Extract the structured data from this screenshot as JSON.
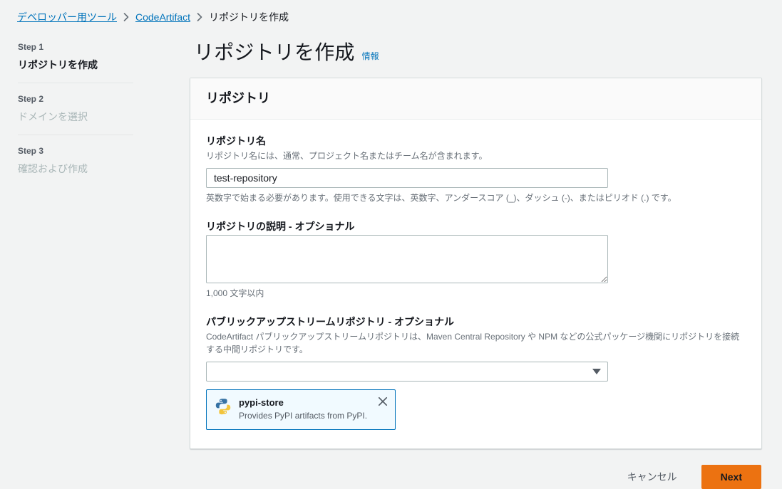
{
  "breadcrumb": {
    "items": [
      {
        "label": "デベロッパー用ツール",
        "type": "link"
      },
      {
        "label": "CodeArtifact",
        "type": "link"
      },
      {
        "label": "リポジトリを作成",
        "type": "current"
      }
    ]
  },
  "sidebar": {
    "steps": [
      {
        "step_label": "Step 1",
        "title": "リポジトリを作成",
        "state": "active"
      },
      {
        "step_label": "Step 2",
        "title": "ドメインを選択",
        "state": "inactive"
      },
      {
        "step_label": "Step 3",
        "title": "確認および作成",
        "state": "inactive"
      }
    ]
  },
  "page": {
    "title": "リポジトリを作成",
    "info_link": "情報"
  },
  "card": {
    "header": "リポジトリ",
    "fields": {
      "repo_name": {
        "label": "リポジトリ名",
        "description": "リポジトリ名には、通常、プロジェクト名またはチーム名が含まれます。",
        "value": "test-repository",
        "placeholder": "",
        "constraint": "英数字で始まる必要があります。使用できる文字は、英数字、アンダースコア (_)、ダッシュ (-)、またはピリオド (.) です。"
      },
      "repo_description": {
        "label": "リポジトリの説明 - オプショナル",
        "value": "",
        "placeholder": "",
        "constraint": "1,000 文字以内"
      },
      "upstream": {
        "label": "パブリックアップストリームリポジトリ - オプショナル",
        "description": "CodeArtifact パブリックアップストリームリポジトリは、Maven Central Repository や NPM などの公式パッケージ機関にリポジトリを接続する中間リポジトリです。",
        "selected_value": "",
        "dropdown_icon": "chevron-down-icon",
        "tokens": [
          {
            "icon": "python-logo-icon",
            "title": "pypi-store",
            "subtitle": "Provides PyPI artifacts from PyPI.",
            "remove_icon": "close-icon"
          }
        ]
      }
    }
  },
  "footer": {
    "cancel_label": "キャンセル",
    "next_label": "Next"
  },
  "colors": {
    "page_background": "#f2f3f3",
    "card_background": "#ffffff",
    "card_header_background": "#fafafa",
    "link": "#0073bb",
    "primary_button": "#ec7211",
    "token_background": "#f1faff",
    "token_border": "#0073bb",
    "muted_text": "#687078",
    "disabled_text": "#aab7b8"
  }
}
